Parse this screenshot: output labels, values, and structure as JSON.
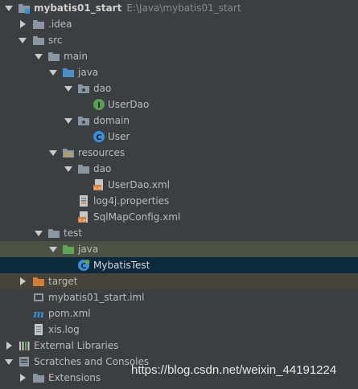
{
  "project": {
    "name": "mybatis01_start",
    "path": "E:\\Java\\mybatis01_start"
  },
  "tree": [
    {
      "label": ".idea",
      "icon": "folder-icon"
    },
    {
      "label": "src",
      "icon": "folder-icon"
    },
    {
      "label": "main",
      "icon": "folder-icon"
    },
    {
      "label": "java",
      "icon": "source-folder-icon"
    },
    {
      "label": "dao",
      "icon": "package-icon"
    },
    {
      "label": "UserDao",
      "icon": "interface-icon"
    },
    {
      "label": "domain",
      "icon": "package-icon"
    },
    {
      "label": "User",
      "icon": "class-icon"
    },
    {
      "label": "resources",
      "icon": "resources-folder-icon"
    },
    {
      "label": "dao",
      "icon": "folder-icon"
    },
    {
      "label": "UserDao.xml",
      "icon": "xml-file-icon"
    },
    {
      "label": "log4j.properties",
      "icon": "properties-file-icon"
    },
    {
      "label": "SqlMapConfig.xml",
      "icon": "xml-file-icon"
    },
    {
      "label": "test",
      "icon": "folder-icon"
    },
    {
      "label": "java",
      "icon": "test-source-folder-icon"
    },
    {
      "label": "MybatisTest",
      "icon": "test-class-icon"
    },
    {
      "label": "target",
      "icon": "excluded-folder-icon"
    },
    {
      "label": "mybatis01_start.iml",
      "icon": "iml-file-icon"
    },
    {
      "label": "pom.xml",
      "icon": "maven-icon"
    },
    {
      "label": "xis.log",
      "icon": "text-file-icon"
    },
    {
      "label": "External Libraries",
      "icon": "libraries-icon"
    },
    {
      "label": "Scratches and Consoles",
      "icon": "scratches-icon"
    },
    {
      "label": "Extensions",
      "icon": "folder-icon"
    }
  ],
  "watermark": "https://blog.csdn.net/weixin_44191224",
  "colors": {
    "background": "#3c3f41",
    "selected": "#0d293e",
    "test_row": "#4b5244",
    "excluded_row": "#47433b",
    "folder": "#8a96a3",
    "source_folder": "#4e8ec6",
    "test_folder": "#62a455",
    "excluded_folder": "#d07e3c",
    "interface": "#5aa053",
    "class": "#3b8fd4"
  }
}
